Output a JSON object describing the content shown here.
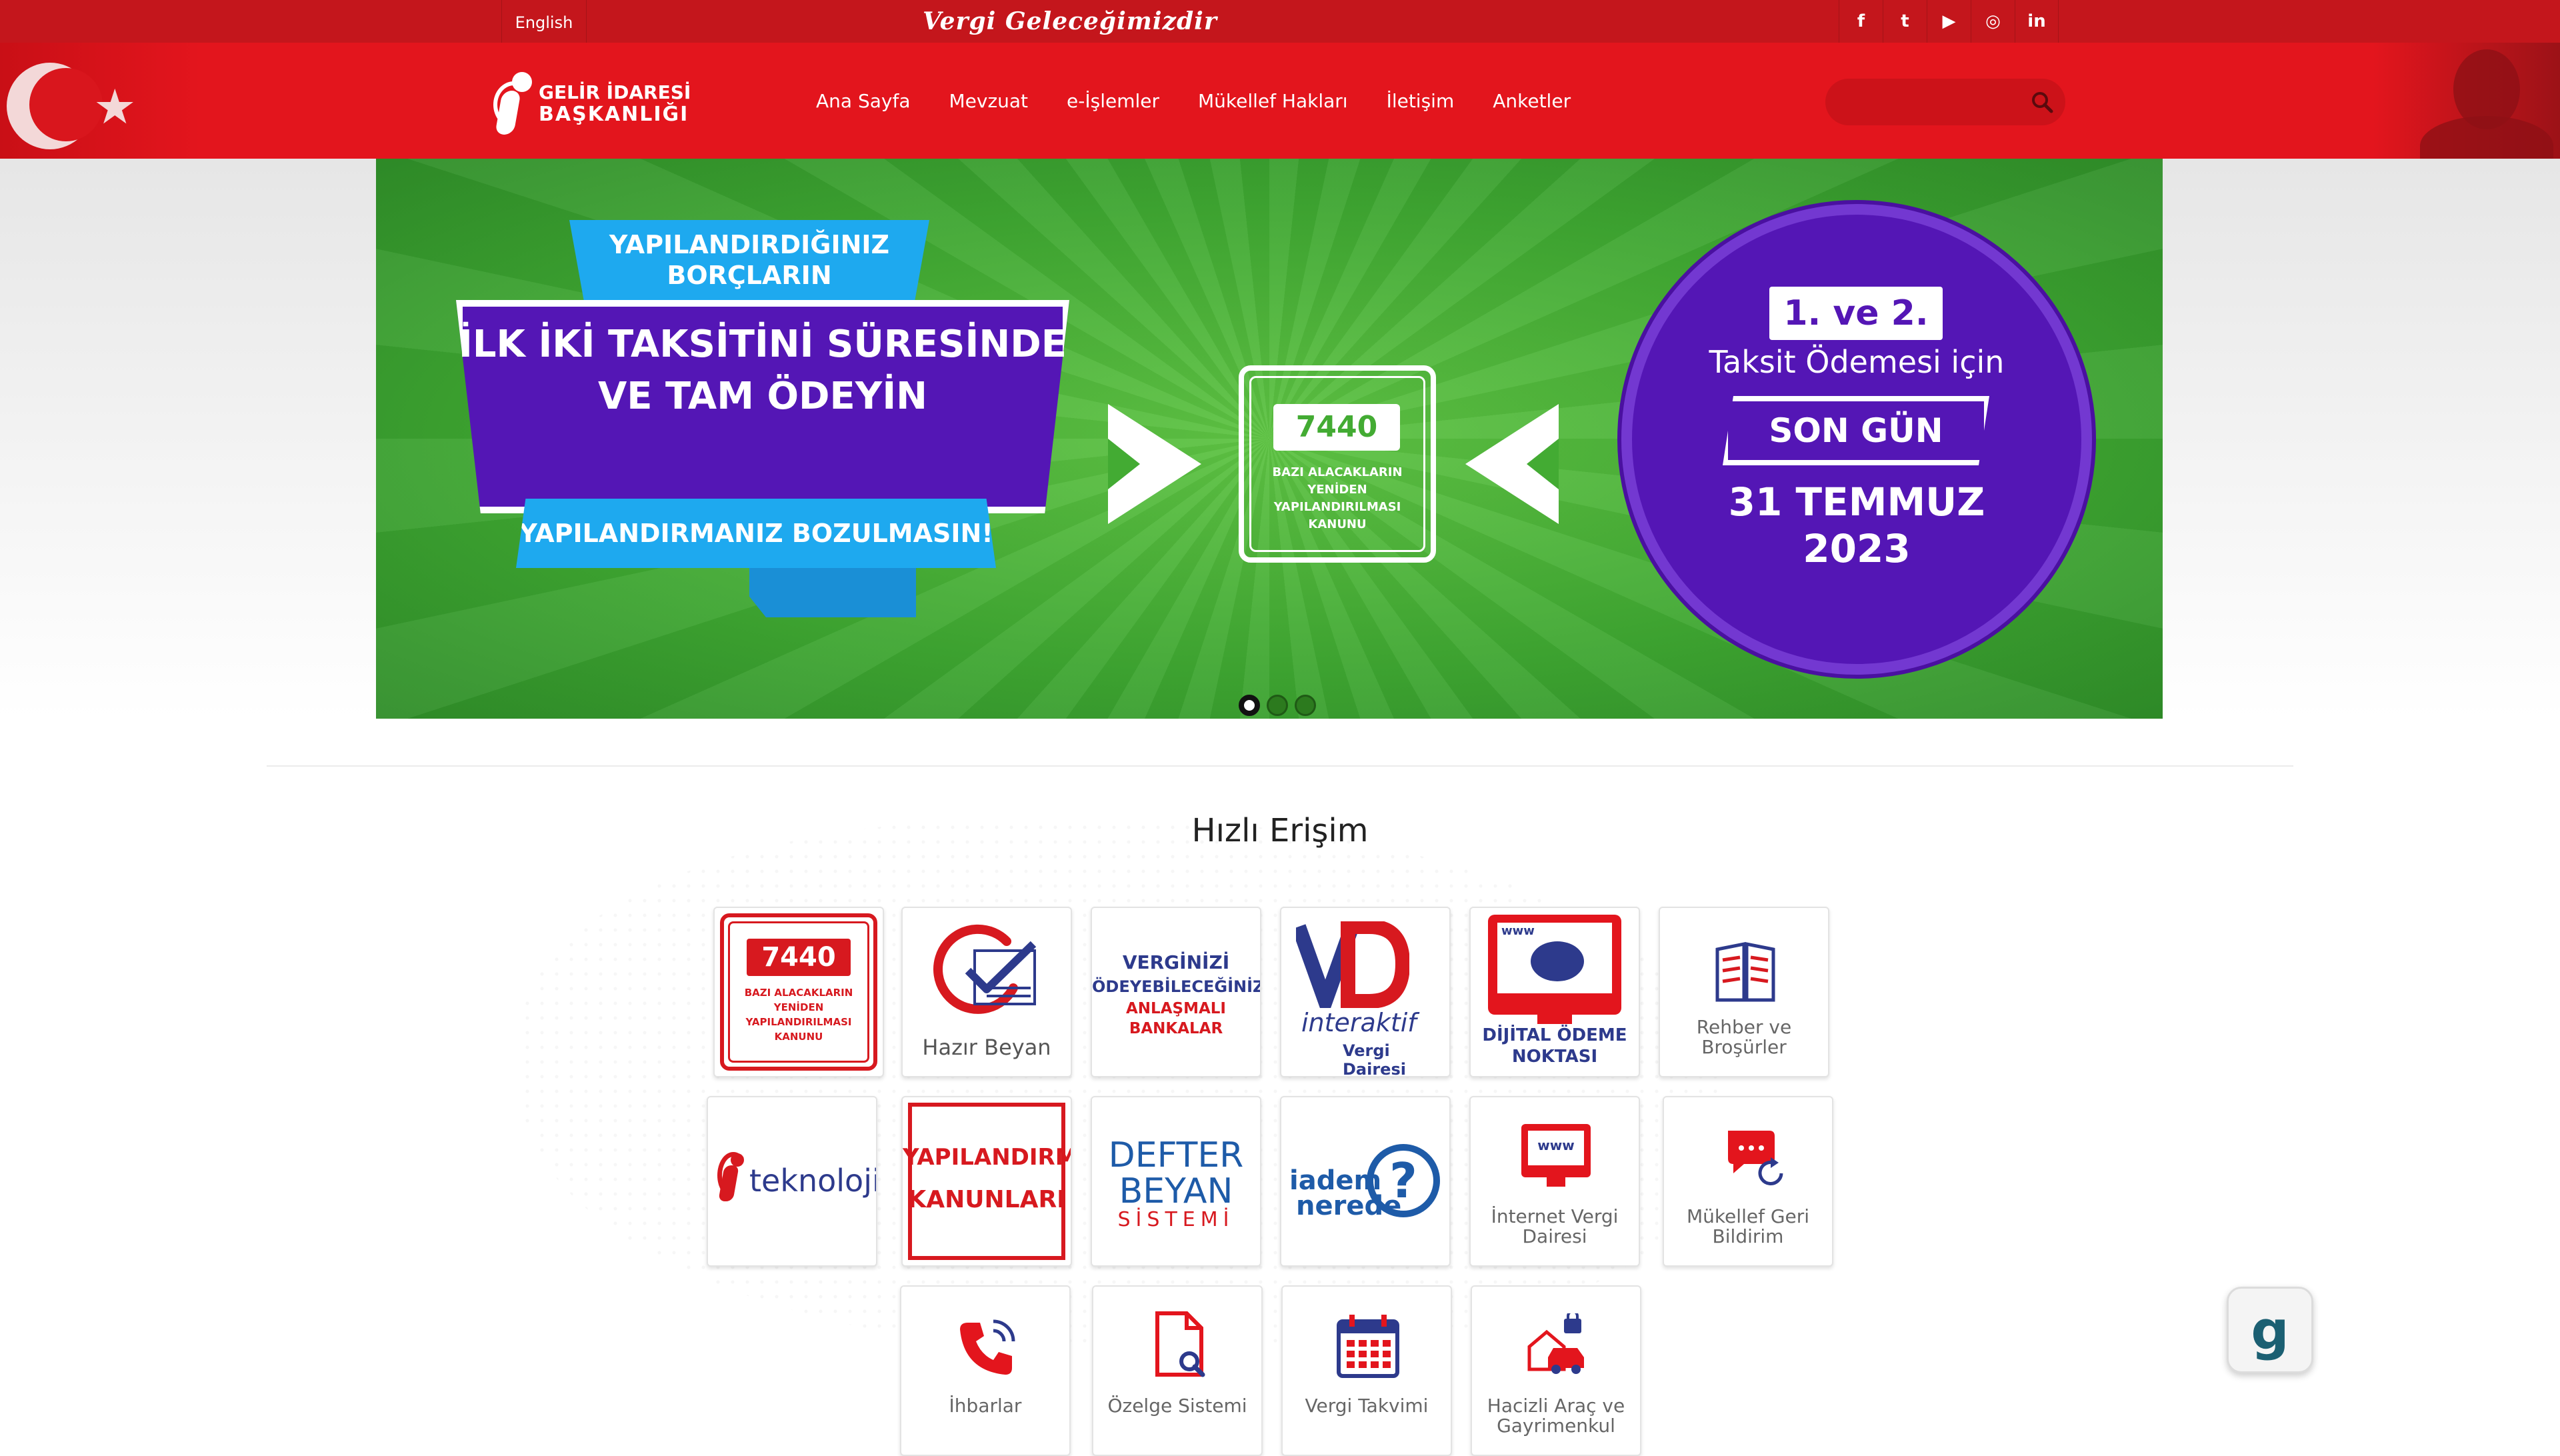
{
  "topbar": {
    "lang_label": "English",
    "slogan": "Vergi Geleceğimizdir",
    "social": [
      {
        "icon": "facebook-icon",
        "glyph": "f"
      },
      {
        "icon": "twitter-icon",
        "glyph": "t"
      },
      {
        "icon": "youtube-icon",
        "glyph": "▶"
      },
      {
        "icon": "instagram-icon",
        "glyph": "◎"
      },
      {
        "icon": "linkedin-icon",
        "glyph": "in"
      }
    ]
  },
  "header": {
    "logo": {
      "line1": "GELİR İDARESİ",
      "line2": "BAŞKANLIĞI"
    },
    "nav": [
      "Ana Sayfa",
      "Mevzuat",
      "e-İşlemler",
      "Mükellef Hakları",
      "İletişim",
      "Anketler"
    ],
    "search": {
      "placeholder": ""
    }
  },
  "banner": {
    "tag1": "YAPILANDIRDIĞINIZ BORÇLARIN",
    "main": "İLK İKİ TAKSİTİNİ SÜRESİNDE VE TAM ÖDEYİN",
    "tag2": "YAPILANDIRMANIZ BOZULMASIN!",
    "box_number": "7440",
    "box_caption": "BAZI ALACAKLARIN YENİDEN YAPILANDIRILMASI KANUNU",
    "circle_badge": "1. ve 2.",
    "circle_line": "Taksit Ödemesi için",
    "circle_badge2": "SON GÜN",
    "circle_date1": "31 TEMMUZ",
    "circle_date2": "2023",
    "slide_count": 3,
    "active_slide": 1
  },
  "quick_access": {
    "title": "Hızlı Erişim",
    "tiles": [
      {
        "name": "7440-kanunu",
        "num": "7440",
        "caption": "BAZI ALACAKLARIN YENİDEN YAPILANDIRILMASI KANUNU"
      },
      {
        "name": "hazir-beyan",
        "caption": "Hazır Beyan"
      },
      {
        "name": "anlasmali-bankalar",
        "l1": "VERGİNİZİ",
        "l2": "ÖDEYEBİLECEĞİNİZ",
        "l3": "ANLAŞMALI BANKALAR"
      },
      {
        "name": "interaktif-vergi-dairesi",
        "l1": "interaktif",
        "l2": "Vergi Dairesi"
      },
      {
        "name": "dijital-odeme-noktasi",
        "l1": "DİJİTAL ÖDEME",
        "l2": "NOKTASI",
        "www": "www"
      },
      {
        "name": "rehber-brosurler",
        "label": "Rehber ve Broşürler"
      },
      {
        "name": "i-teknoloji",
        "text": "teknoloji"
      },
      {
        "name": "yapilandirma-kanunlari",
        "l1": "YAPILANDIRMA",
        "l2": "KANUNLARI"
      },
      {
        "name": "defter-beyan",
        "l1": "DEFTER",
        "l2": "BEYAN",
        "l3": "SİSTEMİ"
      },
      {
        "name": "iadem-nerede",
        "l1": "iadem",
        "l2": "nerede"
      },
      {
        "name": "internet-vergi-dairesi",
        "label": "İnternet Vergi Dairesi",
        "www": "www"
      },
      {
        "name": "mukellef-geri-bildirim",
        "label": "Mükellef Geri Bildirim"
      },
      {
        "name": "ihbarlar",
        "label": "İhbarlar"
      },
      {
        "name": "ozelge-sistemi",
        "label": "Özelge Sistemi"
      },
      {
        "name": "vergi-takvimi",
        "label": "Vergi Takvimi"
      },
      {
        "name": "hacizli-arac",
        "label": "Hacizli Araç ve Gayrimenkul"
      }
    ]
  },
  "assistant": {
    "glyph": "g"
  },
  "colors": {
    "brand_red": "#e3151d",
    "topbar_red": "#c4161c",
    "banner_green": "#43ab33",
    "banner_purple": "#5416b5",
    "banner_blue": "#1ea9ef"
  }
}
